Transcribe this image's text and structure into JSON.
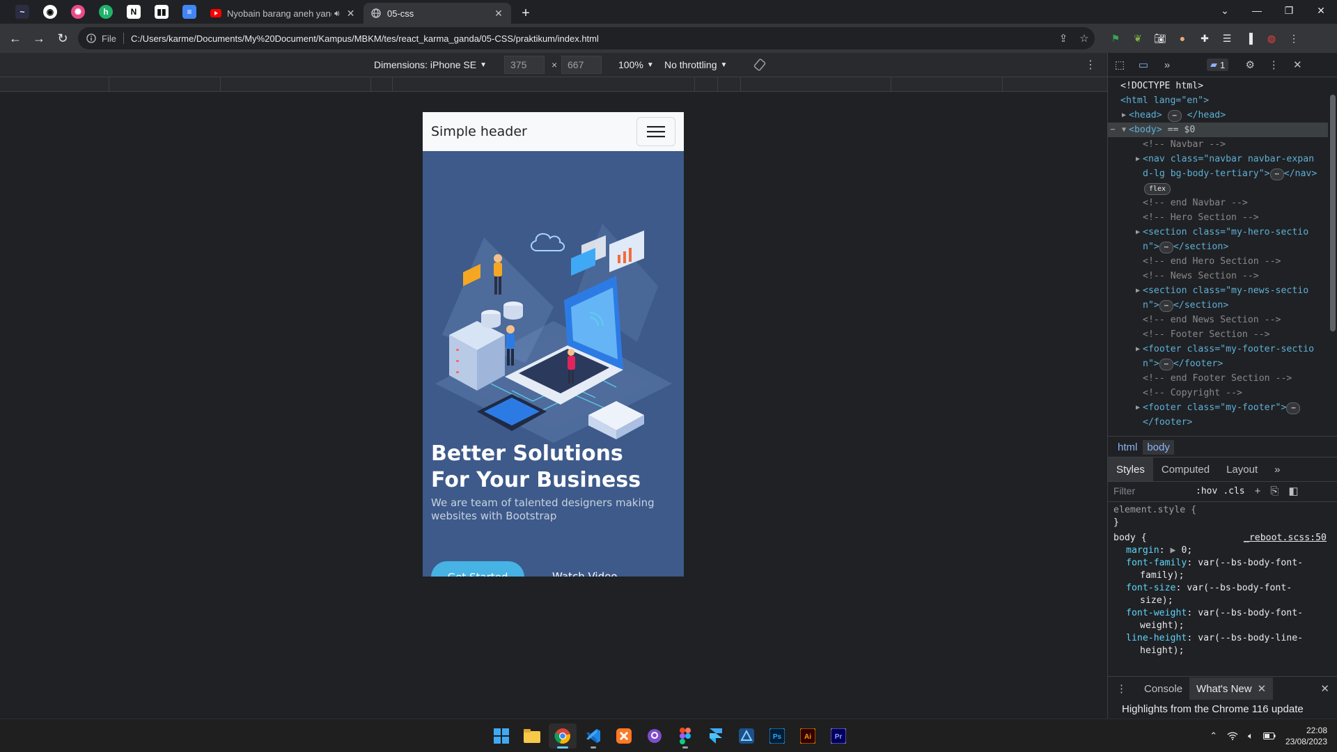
{
  "browser": {
    "tabs": [
      {
        "title": "Nyobain barang aneh yang c",
        "active": false
      },
      {
        "title": "05-css",
        "active": true
      }
    ],
    "url": "C:/Users/karme/Documents/My%20Document/Kampus/MBKM/tes/react_karma_ganda/05-CSS/praktikum/index.html",
    "file_label": "File"
  },
  "devicebar": {
    "dimensions_label": "Dimensions: iPhone SE",
    "width": "375",
    "height": "667",
    "times": "×",
    "zoom": "100%",
    "throttling": "No throttling"
  },
  "page": {
    "brand": "Simple header",
    "heading": "Better Solutions For Your Business",
    "subheading": "We are team of talented designers making websites with Bootstrap",
    "cta": "Get Started",
    "watch": "Watch Video"
  },
  "devtools": {
    "issues_count": "1",
    "elements": {
      "doctype": "<!DOCTYPE html>",
      "html_open": "<html lang=\"en\">",
      "head": "<head>",
      "head_close": "</head>",
      "body": "<body>",
      "body_ref": "== $0",
      "c_navbar": "<!-- Navbar -->",
      "nav_line1": "<nav class=\"navbar navbar-expan",
      "nav_line2": "d-lg bg-body-tertiary\">",
      "nav_close": "</nav>",
      "flex": "flex",
      "c_end_navbar": "<!-- end Navbar -->",
      "c_hero": "<!-- Hero Section -->",
      "hero_line1": "<section class=\"my-hero-sectio",
      "hero_line2": "n\">",
      "section_close": "</section>",
      "c_end_hero": "<!-- end Hero Section -->",
      "c_news": "<!-- News Section -->",
      "news_line1": "<section class=\"my-news-sectio",
      "news_line2": "n\">",
      "c_end_news": "<!-- end News Section -->",
      "c_footer": "<!-- Footer Section -->",
      "footer_line1": "<footer class=\"my-footer-sectio",
      "footer_line2": "n\">",
      "footer_close": "</footer>",
      "c_end_footer": "<!-- end Footer Section -->",
      "c_copyright": "<!-- Copyright -->",
      "copy_line1": "<footer class=\"my-footer\">",
      "copy_line2": "</footer>"
    },
    "breadcrumb": [
      "html",
      "body"
    ],
    "style_tabs": [
      "Styles",
      "Computed",
      "Layout"
    ],
    "filter_placeholder": "Filter",
    "hov": ":hov",
    "cls": ".cls",
    "styles": {
      "element_style": "element.style {",
      "close": "}",
      "body_sel": "body {",
      "source": "_reboot.scss:50",
      "margin_prop": "margin",
      "margin_val": "0;",
      "ff_prop": "font-family",
      "ff_val1": "var(--bs-body-font-",
      "ff_val2": "family);",
      "fs_prop": "font-size",
      "fs_val1": "var(--bs-body-font-",
      "fs_val2": "size);",
      "fw_prop": "font-weight",
      "fw_val1": "var(--bs-body-font-",
      "fw_val2": "weight);",
      "lh_prop": "line-height",
      "lh_val1": "var(--bs-body-line-",
      "lh_val2": "height);"
    },
    "drawer_tabs": [
      "Console",
      "What's New"
    ],
    "whats_new": "Highlights from the Chrome 116 update"
  },
  "taskbar": {
    "time": "22:08",
    "date": "23/08/2023",
    "apps": [
      "windows-start",
      "file-explorer",
      "chrome",
      "vscode",
      "xampp",
      "github-desktop",
      "figma",
      "framer",
      "vectornator",
      "photoshop",
      "illustrator",
      "premiere-pro"
    ],
    "ps": "Ps",
    "ai": "Ai",
    "pr": "Pr"
  },
  "colors": {
    "hero_bg": "#3d5a8a",
    "accent": "#47b2e4",
    "devtools_bg": "#202124",
    "chrome_toolbar": "#35363a"
  }
}
